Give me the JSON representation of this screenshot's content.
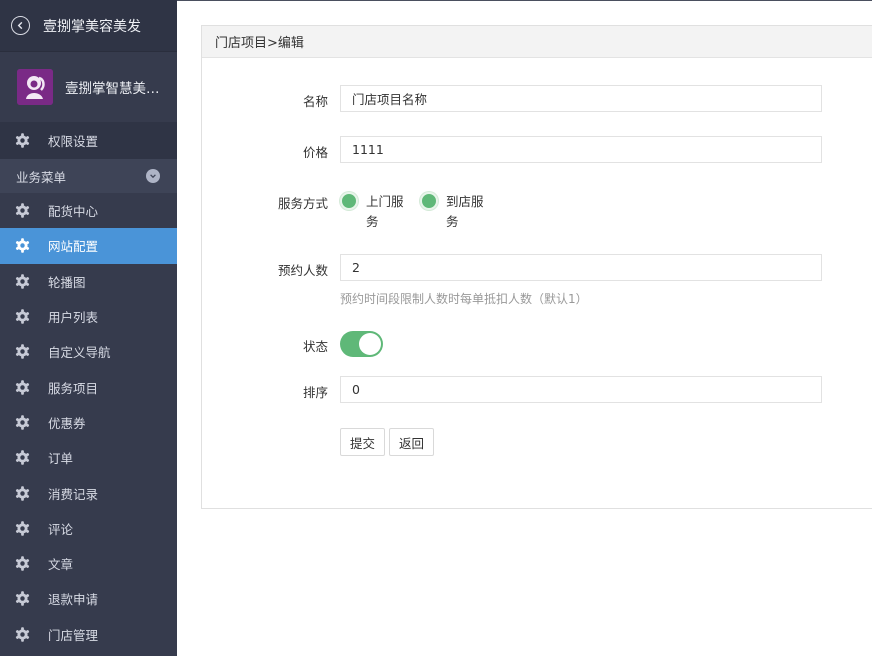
{
  "sidebar": {
    "header_title": "壹捌掌美容美发",
    "profile_name": "壹捌掌智慧美容...",
    "top_item": "权限设置",
    "section_label": "业务菜单",
    "items": [
      {
        "label": "配货中心"
      },
      {
        "label": "网站配置",
        "active": true
      },
      {
        "label": "轮播图"
      },
      {
        "label": "用户列表"
      },
      {
        "label": "自定义导航"
      },
      {
        "label": "服务项目"
      },
      {
        "label": "优惠券"
      },
      {
        "label": "订单"
      },
      {
        "label": "消费记录"
      },
      {
        "label": "评论"
      },
      {
        "label": "文章"
      },
      {
        "label": "退款申请"
      },
      {
        "label": "门店管理"
      }
    ]
  },
  "panel": {
    "breadcrumb": "门店项目>编辑",
    "form": {
      "name_label": "名称",
      "name_value": "门店项目名称",
      "price_label": "价格",
      "price_value": "1111",
      "service_label": "服务方式",
      "service_options": [
        "上门服务",
        "到店服务"
      ],
      "booking_label": "预约人数",
      "booking_value": "2",
      "booking_hint": "预约时间段限制人数时每单抵扣人数（默认1）",
      "status_label": "状态",
      "status_on": true,
      "sort_label": "排序",
      "sort_value": "0",
      "submit_label": "提交",
      "back_label": "返回"
    }
  },
  "colors": {
    "sidebar_bg": "#363b4d",
    "active_bg": "#4a94d8",
    "accent_green": "#5fb878"
  },
  "icons": {
    "back": "back-arrow-circle-icon",
    "menu": "gear-icon",
    "section_toggle": "chevron-down-icon",
    "avatar": "avatar-logo"
  }
}
